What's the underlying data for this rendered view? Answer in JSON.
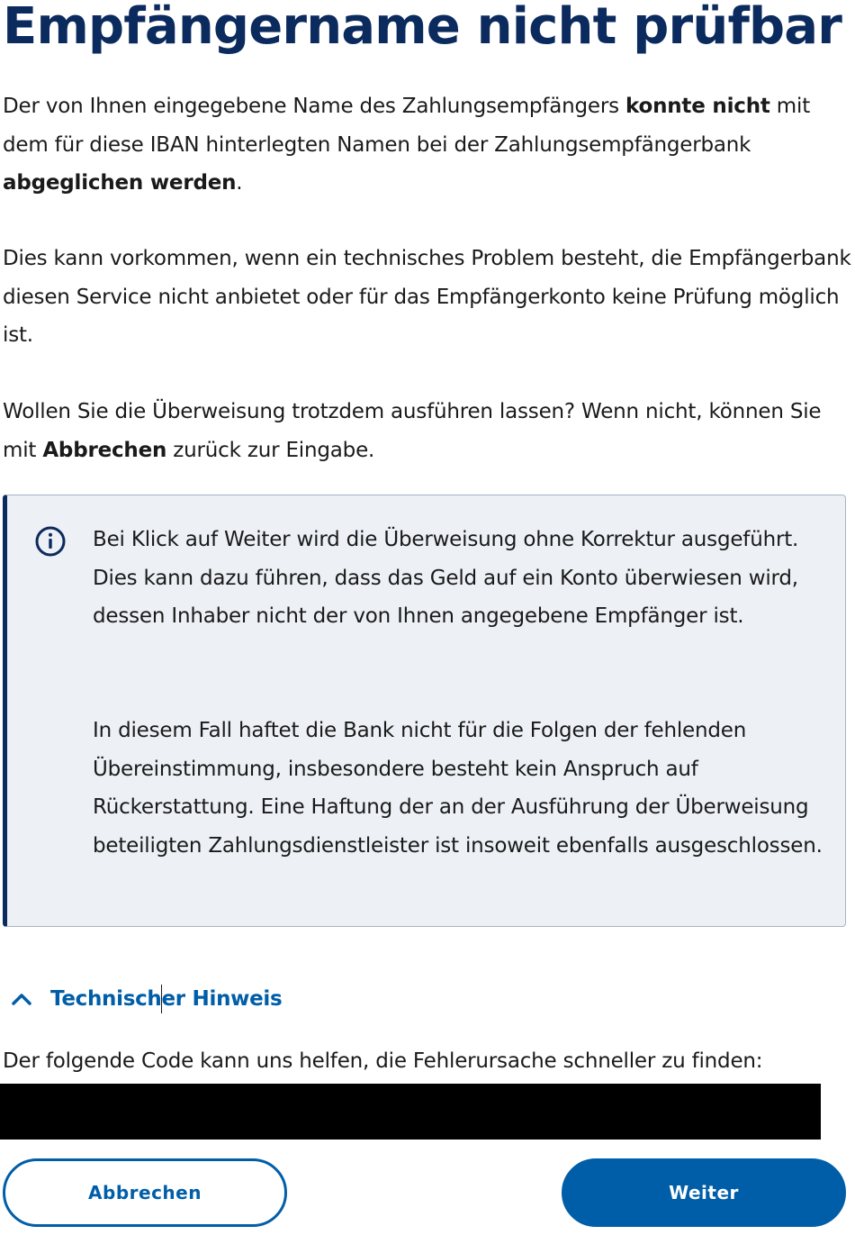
{
  "title": "Empfängername nicht prüfbar",
  "paragraph1": {
    "t1": "Der von Ihnen eingegebene Name des Zahlungsempfängers ",
    "b1": "konnte nicht",
    "t2": " mit dem für diese IBAN hinterlegten Namen bei der Zahlungsempfängerbank ",
    "b2": "abgeglichen werden",
    "t3": "."
  },
  "paragraph2": "Dies kann vorkommen, wenn ein technisches Problem besteht, die Empfängerbank diesen Service nicht anbietet oder für das Empfängerkonto keine Prüfung möglich ist.",
  "paragraph3": {
    "t1": "Wollen Sie die Überweisung trotzdem ausführen lassen? Wenn nicht, können Sie mit ",
    "b1": "Abbrechen",
    "t2": " zurück zur Eingabe."
  },
  "info_box": {
    "icon": "info-circle-icon",
    "text1": "Bei Klick auf Weiter wird die Überweisung ohne Korrektur ausgeführt. Dies kann dazu führen, dass das Geld auf ein Konto überwiesen wird, dessen Inhaber nicht der von Ihnen angegebene Empfänger ist.",
    "text2": "In diesem Fall haftet die Bank nicht für die Folgen der fehlenden Übereinstimmung, insbesondere besteht kein Anspruch auf Rückerstattung. Eine Haftung der an der Ausführung der Überweisung beteiligten Zahlungsdienstleister ist insoweit ebenfalls ausgeschlossen."
  },
  "technical_note": {
    "icon": "chevron-up-icon",
    "label": "Technischer Hinweis",
    "description": "Der folgende Code kann uns helfen, die Fehlerursache schneller zu finden:"
  },
  "buttons": {
    "cancel": "Abbrechen",
    "next": "Weiter"
  },
  "colors": {
    "title": "#0b2a5e",
    "accent": "#005ea8",
    "info_background": "#edf0f5"
  }
}
